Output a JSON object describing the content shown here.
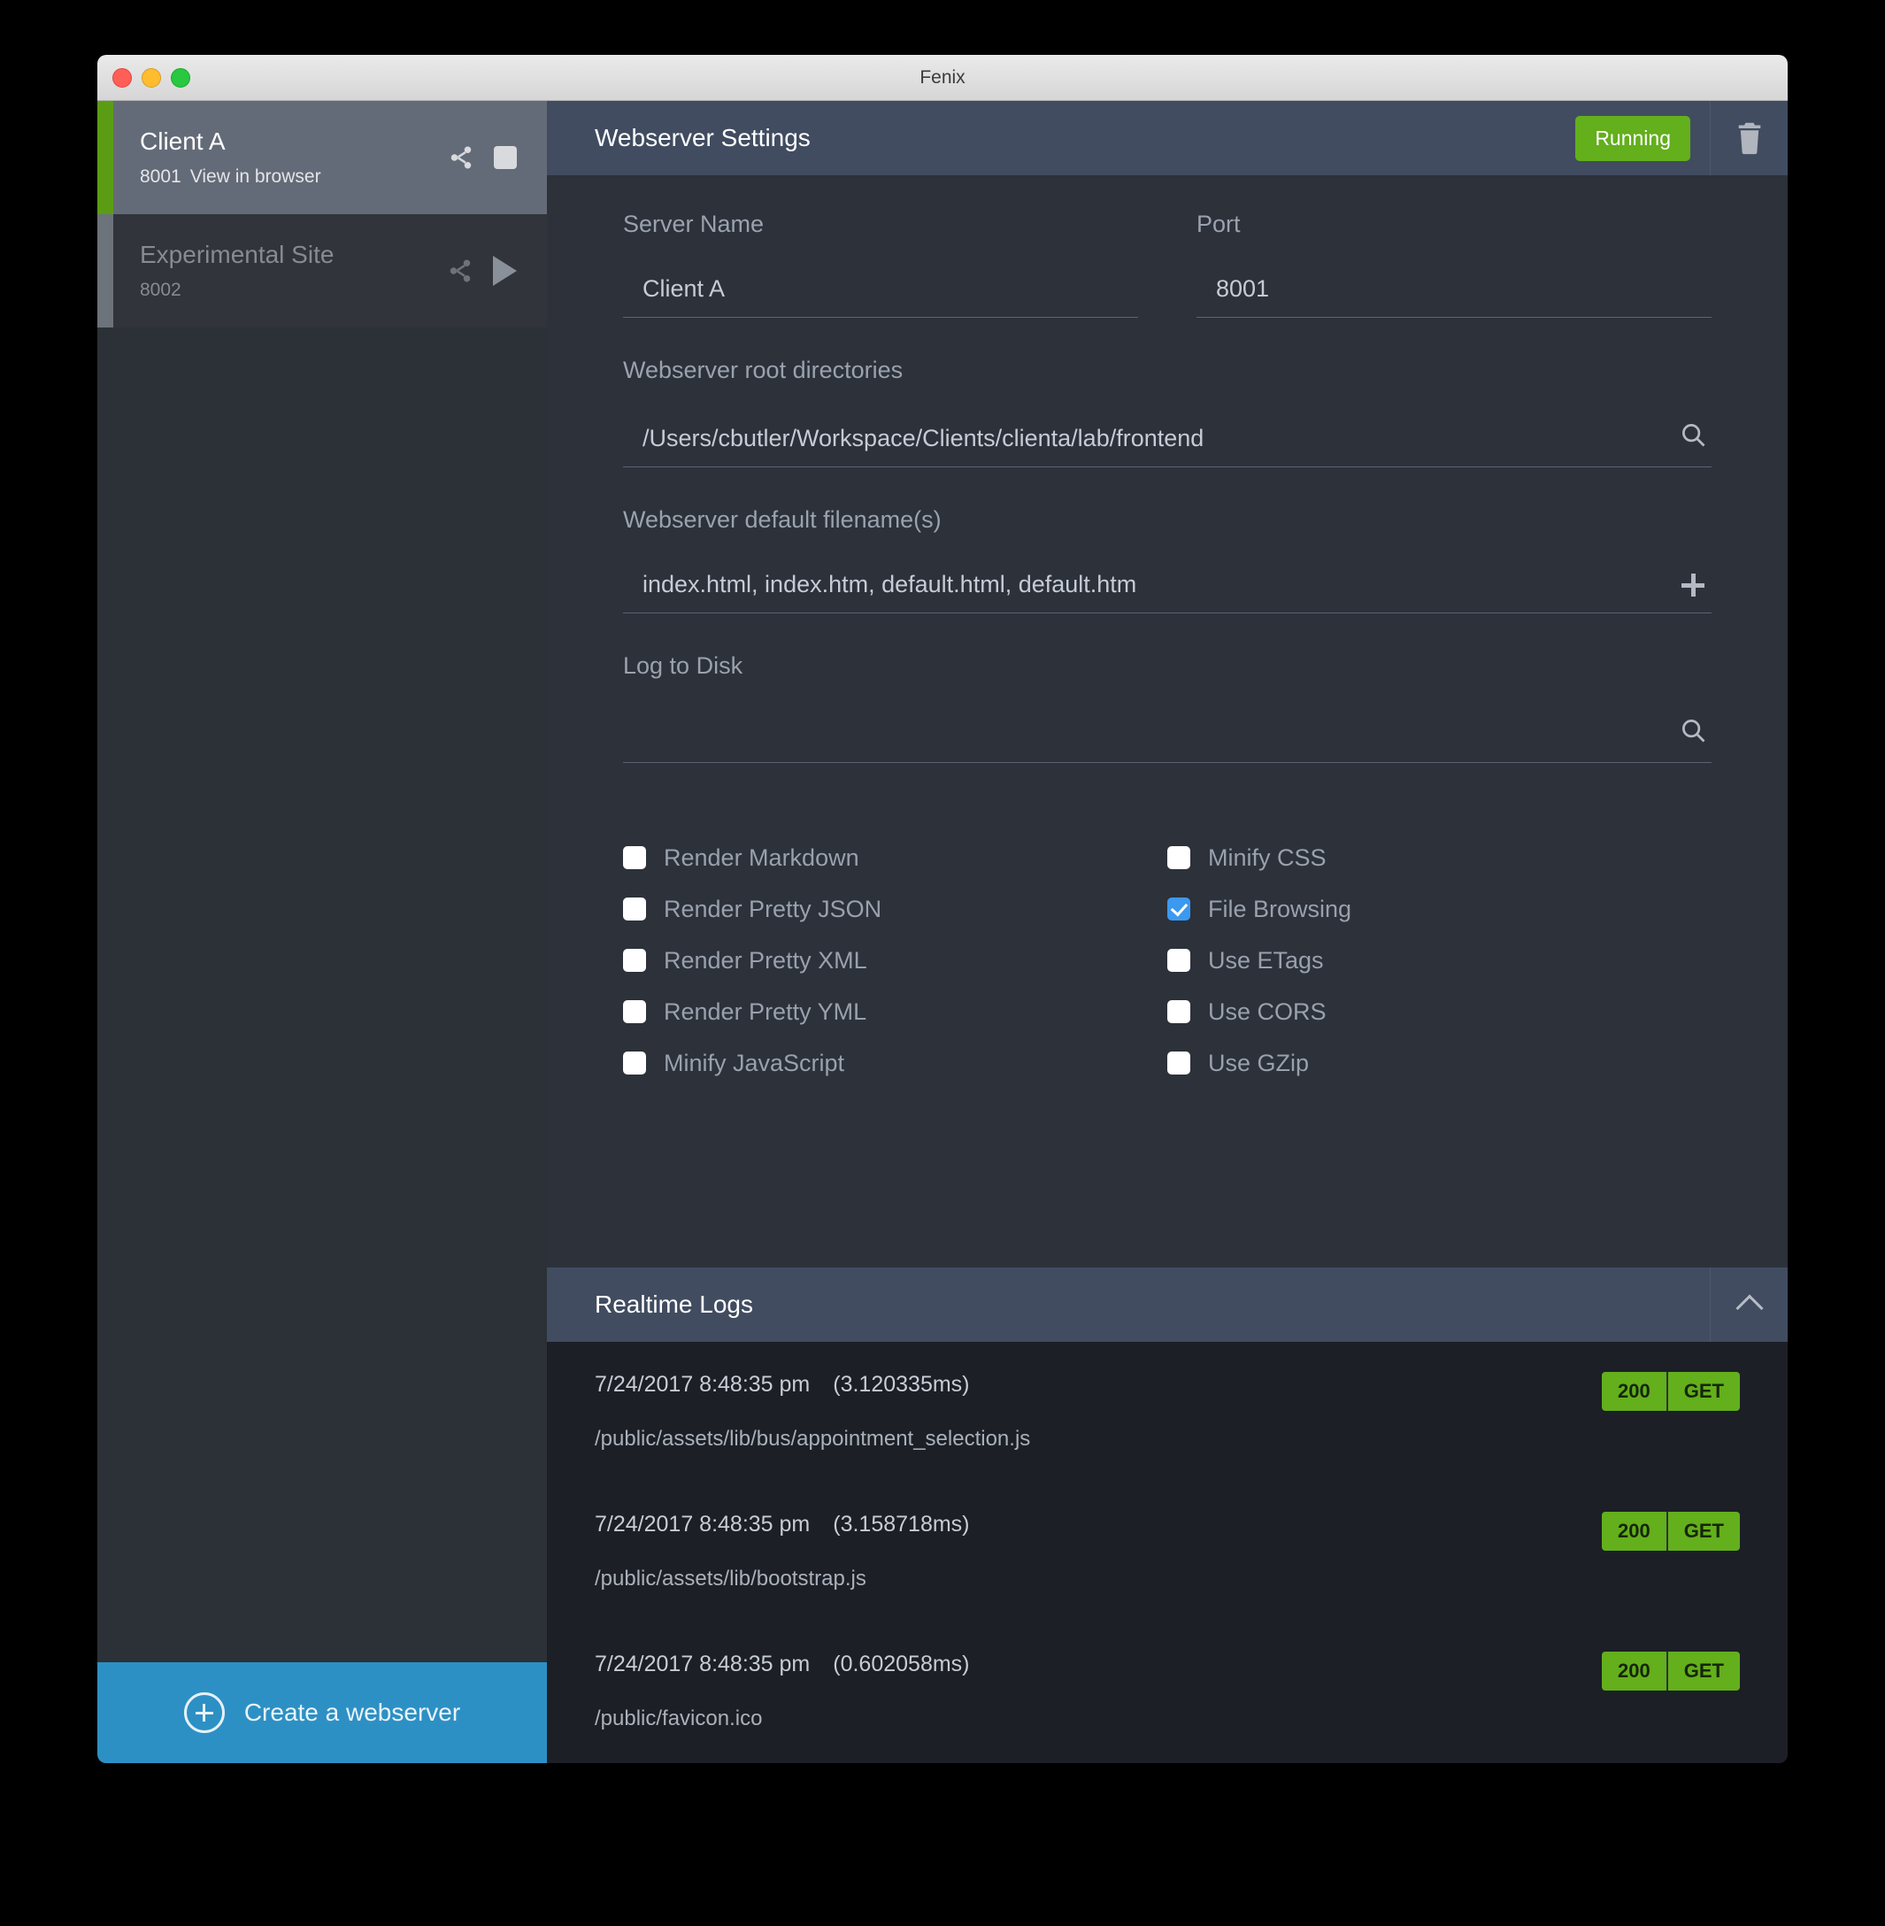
{
  "window": {
    "title": "Fenix",
    "traffic_lights": [
      "close",
      "minimize",
      "zoom"
    ]
  },
  "sidebar": {
    "servers": [
      {
        "name": "Client A",
        "port": "8001",
        "sub_action": "View in browser",
        "state": "running",
        "active": true,
        "actions": [
          "share-icon",
          "stop-icon"
        ]
      },
      {
        "name": "Experimental Site",
        "port": "8002",
        "sub_action": "",
        "state": "stopped",
        "active": false,
        "actions": [
          "share-icon",
          "play-icon"
        ]
      }
    ],
    "create_button": {
      "label": "Create a webserver",
      "icon": "plus-circle-icon",
      "color": "#2d90c4"
    }
  },
  "main": {
    "header": {
      "title": "Webserver Settings",
      "status_badge": "Running",
      "status_color": "#63af1c",
      "delete_icon": "trash-icon"
    },
    "fields": {
      "server_name": {
        "label": "Server Name",
        "value": "Client A",
        "placeholder": ""
      },
      "port": {
        "label": "Port",
        "value": "8001",
        "placeholder": ""
      },
      "root_directories": {
        "label": "Webserver root directories",
        "value": "/Users/cbutler/Workspace/Clients/clienta/lab/frontend",
        "action_icon": "search-icon"
      },
      "default_filenames": {
        "label": "Webserver default filename(s)",
        "value": "index.html, index.htm, default.html, default.htm",
        "action_icon": "plus-icon"
      },
      "log_to_disk": {
        "label": "Log to Disk",
        "value": "",
        "action_icon": "search-icon"
      }
    },
    "options": {
      "left_column": [
        {
          "label": "Render Markdown",
          "checked": false
        },
        {
          "label": "Render Pretty JSON",
          "checked": false
        },
        {
          "label": "Render Pretty XML",
          "checked": false
        },
        {
          "label": "Render Pretty YML",
          "checked": false
        },
        {
          "label": "Minify JavaScript",
          "checked": false
        }
      ],
      "right_column": [
        {
          "label": "Minify CSS",
          "checked": false
        },
        {
          "label": "File Browsing",
          "checked": true
        },
        {
          "label": "Use ETags",
          "checked": false
        },
        {
          "label": "Use CORS",
          "checked": false
        },
        {
          "label": "Use GZip",
          "checked": false
        }
      ],
      "checked_color": "#3b99f0"
    }
  },
  "logs": {
    "title": "Realtime Logs",
    "collapse_icon": "chevron-up-icon",
    "entries": [
      {
        "time": "7/24/2017 8:48:35 pm",
        "duration": "(3.120335ms)",
        "path": "/public/assets/lib/bus/appointment_selection.js",
        "status": "200",
        "method": "GET"
      },
      {
        "time": "7/24/2017 8:48:35 pm",
        "duration": "(3.158718ms)",
        "path": "/public/assets/lib/bootstrap.js",
        "status": "200",
        "method": "GET"
      },
      {
        "time": "7/24/2017 8:48:35 pm",
        "duration": "(0.602058ms)",
        "path": "/public/favicon.ico",
        "status": "200",
        "method": "GET"
      }
    ]
  }
}
